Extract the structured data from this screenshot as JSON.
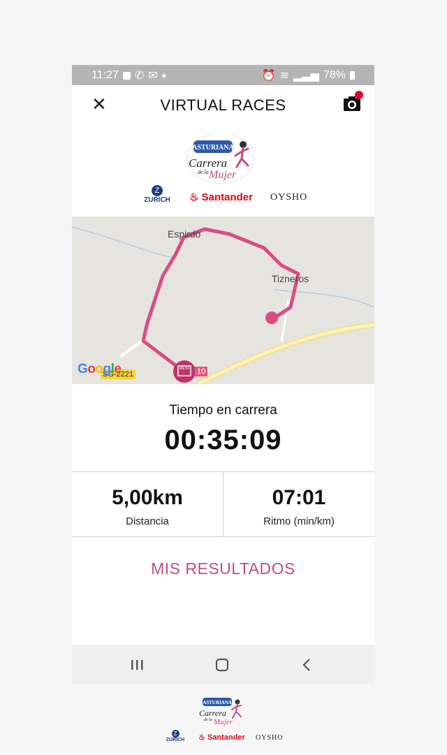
{
  "status_bar": {
    "time": "11:27",
    "battery": "78%"
  },
  "app_bar": {
    "title": "VIRTUAL RACES",
    "close_icon": "close-icon",
    "camera_icon": "camera-icon"
  },
  "logo": {
    "brand": "ASTURIANA",
    "title_line1": "Carrera",
    "title_line2": "de la",
    "title_line3": "Mujer"
  },
  "sponsors": [
    "ZURICH",
    "Santander",
    "OYSHO"
  ],
  "map": {
    "labels": [
      "Espirdo",
      "Tizneros"
    ],
    "road_code": "SG-2221",
    "road_code_right": "10",
    "attribution": "Google",
    "finish_label": "META"
  },
  "race": {
    "time_label": "Tiempo en carrera",
    "time_value": "00:35:09",
    "distance_value": "5,00km",
    "distance_label": "Distancia",
    "pace_value": "07:01",
    "pace_label": "Ritmo (min/km)"
  },
  "results_button": "MIS RESULTADOS",
  "nav": [
    "recent-apps-icon",
    "home-icon",
    "back-icon"
  ],
  "colors": {
    "accent": "#c24d86",
    "route": "#d94c85",
    "status_bar": "#b4b4b4"
  }
}
